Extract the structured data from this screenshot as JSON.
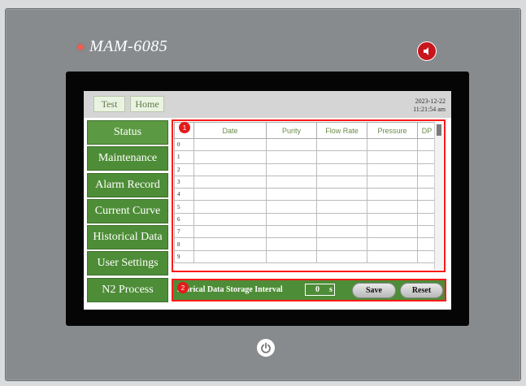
{
  "device": {
    "model": "MAM-6085"
  },
  "topbar": {
    "test_label": "Test",
    "home_label": "Home",
    "date": "2023-12-22",
    "time": "11:21:54 am"
  },
  "sidebar": {
    "items": [
      {
        "label": "Status",
        "active": true
      },
      {
        "label": "Maintenance"
      },
      {
        "label": "Alarm Record"
      },
      {
        "label": "Current Curve"
      },
      {
        "label": "Historical Data"
      },
      {
        "label": "User Settings"
      },
      {
        "label": "N2 Process"
      }
    ]
  },
  "table": {
    "columns": [
      "",
      "Date",
      "Purity",
      "Flow Rate",
      "Pressure",
      "DP"
    ],
    "rows": [
      "0",
      "1",
      "2",
      "3",
      "4",
      "5",
      "6",
      "7",
      "8",
      "9"
    ]
  },
  "annotations": {
    "badge1": "1",
    "badge2": "2"
  },
  "bottom": {
    "label": "istorical Data Storage Interval",
    "interval_value": "0",
    "interval_unit": "s",
    "save_label": "Save",
    "reset_label": "Reset"
  },
  "colors": {
    "nav_green": "#4e8d37",
    "highlight_red": "#ff1a1a",
    "column_text": "#6b8a4a"
  },
  "icons": {
    "speaker": "speaker-icon",
    "power": "power-icon"
  }
}
